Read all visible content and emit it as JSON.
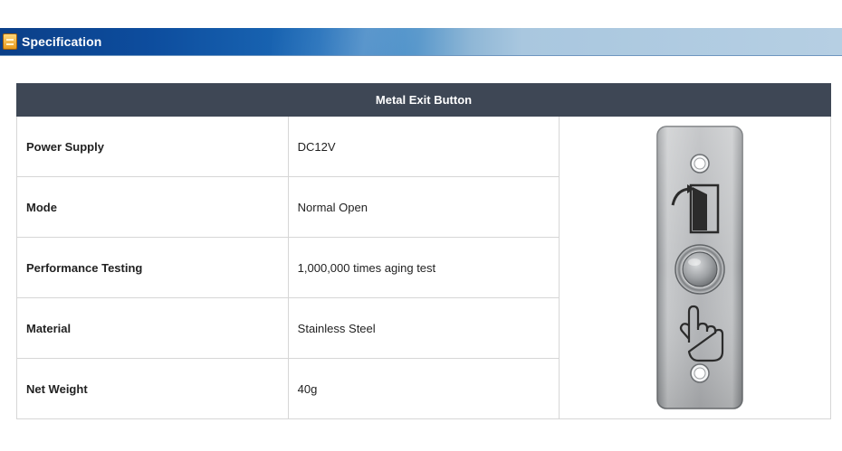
{
  "section": {
    "title": "Specification",
    "icon": "document-icon"
  },
  "table": {
    "header": "Metal Exit Button",
    "rows": [
      {
        "label": "Power Supply",
        "value": "DC12V"
      },
      {
        "label": "Mode",
        "value": "Normal Open"
      },
      {
        "label": "Performance Testing",
        "value": "1,000,000 times aging test"
      },
      {
        "label": "Material",
        "value": "Stainless Steel"
      },
      {
        "label": "Net Weight",
        "value": "40g"
      }
    ]
  },
  "product_image": {
    "icons": [
      "door-open-icon",
      "push-button-icon",
      "pointing-hand-icon"
    ]
  },
  "colors": {
    "banner_dark": "#0b3f88",
    "banner_light": "#b6cfe3",
    "header_bg": "#3e4755",
    "border": "#d6d6d6"
  }
}
